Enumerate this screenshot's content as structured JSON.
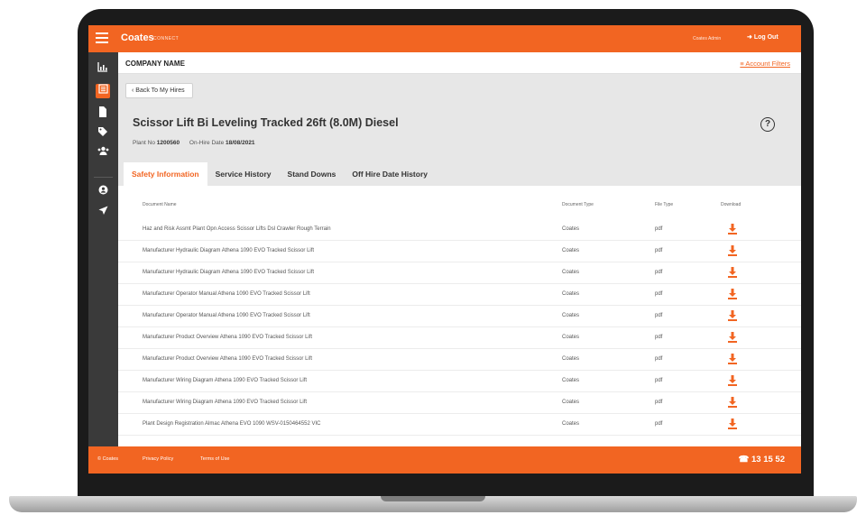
{
  "app": {
    "logo": "Coates",
    "logo_sub": "CONNECT",
    "user_text": "Coates Admin",
    "logout_label": "Log Out"
  },
  "company": {
    "name": "COMPANY NAME",
    "account_filters": "≡ Account Filters"
  },
  "asset": {
    "back_label": "Back To My Hires",
    "title": "Scissor Lift Bi Leveling Tracked 26ft (8.0M) Diesel",
    "plant_no_label": "Plant No",
    "plant_no": "1200560",
    "on_hire_label": "On-Hire Date",
    "on_hire_date": "18/08/2021",
    "help": "?"
  },
  "tabs": [
    {
      "label": "Safety Information"
    },
    {
      "label": "Service History"
    },
    {
      "label": "Stand Downs"
    },
    {
      "label": "Off Hire Date History"
    }
  ],
  "table": {
    "headers": [
      "Document Name",
      "Document Type",
      "File Type",
      "Download"
    ],
    "rows": [
      {
        "name": "Haz and Risk Assmt Plant Opn Access Scissor Lifts Dsl Crawler Rough Terrain",
        "doc_type": "Coates",
        "file_type": "pdf"
      },
      {
        "name": "Manufacturer Hydraulic Diagram Athena 1090 EVO Tracked Scissor Lift",
        "doc_type": "Coates",
        "file_type": "pdf"
      },
      {
        "name": "Manufacturer Hydraulic Diagram Athena 1090 EVO Tracked Scissor Lift",
        "doc_type": "Coates",
        "file_type": "pdf"
      },
      {
        "name": "Manufacturer Operator Manual Athena 1090 EVO Tracked Scissor Lift",
        "doc_type": "Coates",
        "file_type": "pdf"
      },
      {
        "name": "Manufacturer Operator Manual Athena 1090 EVO Tracked Scissor Lift",
        "doc_type": "Coates",
        "file_type": "pdf"
      },
      {
        "name": "Manufacturer Product Overview Athena 1090 EVO Tracked Scissor Lift",
        "doc_type": "Coates",
        "file_type": "pdf"
      },
      {
        "name": "Manufacturer Product Overview Athena 1090 EVO Tracked Scissor Lift",
        "doc_type": "Coates",
        "file_type": "pdf"
      },
      {
        "name": "Manufacturer Wiring Diagram Athena 1090 EVO Tracked Scissor Lift",
        "doc_type": "Coates",
        "file_type": "pdf"
      },
      {
        "name": "Manufacturer Wiring Diagram Athena 1090 EVO Tracked Scissor Lift",
        "doc_type": "Coates",
        "file_type": "pdf"
      },
      {
        "name": "Plant Design Registration Almac Athena EVO 1090 WSV-0150464552 VIC",
        "doc_type": "Coates",
        "file_type": "pdf"
      }
    ]
  },
  "footer": {
    "copyright": "© Coates",
    "privacy": "Privacy Policy",
    "terms": "Terms of Use",
    "phone": "☎ 13 15 52"
  },
  "icons": [
    "menu-icon",
    "chart-icon",
    "list-icon",
    "document-icon",
    "tag-icon",
    "users-icon",
    "account-icon",
    "send-icon",
    "logout-icon",
    "download-icon"
  ],
  "colors": {
    "brand": "#f26522",
    "sidebar": "#3a3a3a"
  }
}
